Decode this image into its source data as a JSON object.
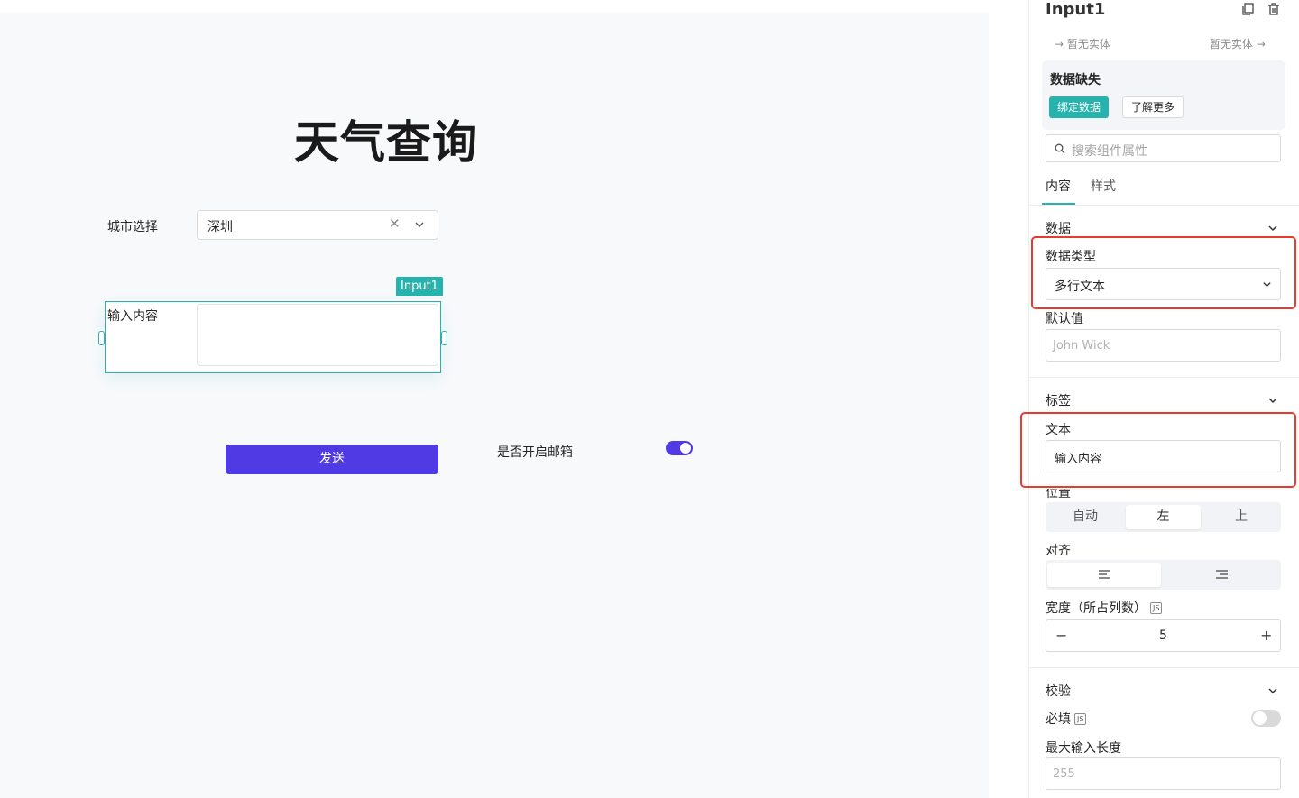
{
  "canvas": {
    "title": "天气查询",
    "city_label": "城市选择",
    "city_value": "深圳",
    "input_label": "输入内容",
    "selected_tag": "Input1",
    "send_label": "发送",
    "email_label": "是否开启邮箱",
    "email_enabled": true
  },
  "panel": {
    "title": "Input1",
    "entity_left": "暂无实体",
    "entity_right": "暂无实体",
    "missing_title": "数据缺失",
    "bind_button": "绑定数据",
    "learn_more_button": "了解更多",
    "search_placeholder": "搜索组件属性",
    "tabs": [
      {
        "label": "内容"
      },
      {
        "label": "样式"
      }
    ],
    "data_section": {
      "title": "数据",
      "type_label": "数据类型",
      "type_value": "多行文本",
      "default_label": "默认值",
      "default_placeholder": "John Wick"
    },
    "label_section": {
      "title": "标签",
      "text_label": "文本",
      "text_value": "输入内容",
      "position_label": "位置",
      "position_options": [
        "自动",
        "左",
        "上"
      ],
      "position_selected": "左",
      "align_label": "对齐",
      "width_label": "宽度（所占列数）",
      "js_badge": "JS",
      "width_value": "5"
    },
    "validation_section": {
      "title": "校验",
      "required_label": "必填",
      "required_enabled": false,
      "maxlen_label": "最大输入长度",
      "maxlen_placeholder": "255"
    }
  }
}
